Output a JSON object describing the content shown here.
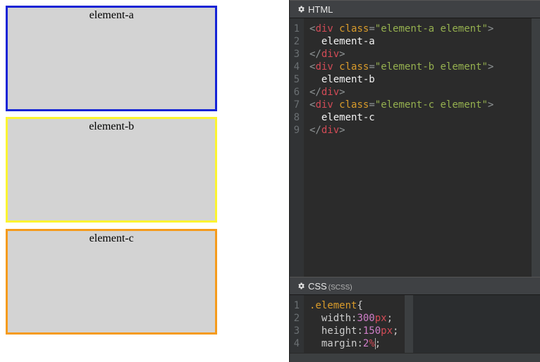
{
  "preview": {
    "element_a_label": "element-a",
    "element_b_label": "element-b",
    "element_c_label": "element-c"
  },
  "editor": {
    "html_header": "HTML",
    "css_header": "CSS",
    "css_sub": "(SCSS)",
    "html_lines": {
      "l1_open": "<",
      "l1_tag": "div",
      "l1_attr": "class",
      "l1_eq": "=",
      "l1_val": "\"element-a element\"",
      "l1_close": ">",
      "l2_text": "  element-a",
      "l3_open": "</",
      "l3_tag": "div",
      "l3_close": ">",
      "l4_open": "<",
      "l4_tag": "div",
      "l4_attr": "class",
      "l4_eq": "=",
      "l4_val": "\"element-b element\"",
      "l4_close": ">",
      "l5_text": "  element-b",
      "l6_open": "</",
      "l6_tag": "div",
      "l6_close": ">",
      "l7_open": "<",
      "l7_tag": "div",
      "l7_attr": "class",
      "l7_eq": "=",
      "l7_val": "\"element-c element\"",
      "l7_close": ">",
      "l8_text": "  element-c",
      "l9_open": "</",
      "l9_tag": "div",
      "l9_close": ">"
    },
    "html_gutter": {
      "n1": "1",
      "n2": "2",
      "n3": "3",
      "n4": "4",
      "n5": "5",
      "n6": "6",
      "n7": "7",
      "n8": "8",
      "n9": "9"
    },
    "css_lines": {
      "l1_sel": ".element",
      "l1_brace": "{",
      "l2_prop": "  width",
      "l2_colon": ":",
      "l2_num": "300",
      "l2_unit": "px",
      "l2_semi": ";",
      "l3_prop": "  height",
      "l3_colon": ":",
      "l3_num": "150",
      "l3_unit": "px",
      "l3_semi": ";",
      "l4_prop": "  margin",
      "l4_colon": ":",
      "l4_num": "2",
      "l4_unit": "%",
      "l4_semi": ";"
    },
    "css_gutter": {
      "n1": "1",
      "n2": "2",
      "n3": "3",
      "n4": "4"
    }
  }
}
